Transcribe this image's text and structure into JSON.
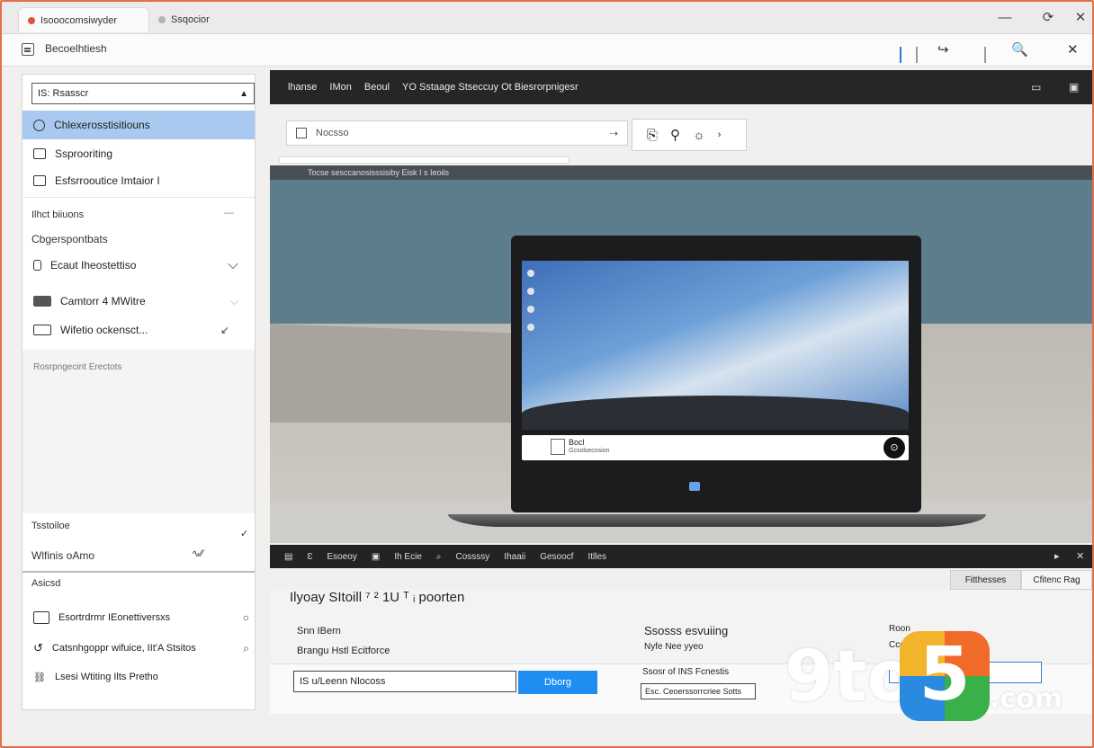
{
  "titlebar": {
    "tabs": [
      {
        "label": "Isooocomsiwyder"
      },
      {
        "label": "Ssqocior"
      }
    ],
    "controls": {
      "minimize": "—",
      "restore": "⟳",
      "close": "✕"
    }
  },
  "toolbar": {
    "address": "Becoelhtiesh",
    "icons": {
      "pin": "↪",
      "search": "🔍",
      "close": "✕"
    }
  },
  "sidebar": {
    "search": {
      "placeholder": "Rsasscr",
      "prefix": "IS:"
    },
    "items": [
      {
        "label": "Chlexerosstisitiouns"
      },
      {
        "label": "Ssprooriting"
      },
      {
        "label": "Esfsrrooutice Imtaior I"
      }
    ],
    "section1": {
      "heading": "Ilhct biiuons",
      "meta": "—"
    },
    "group_label": "Cbgerspontbats",
    "sub_items": [
      {
        "label": "Ecaut Iheostettiso"
      },
      {
        "label": "Camtorr 4 MWitre"
      },
      {
        "label": "Wifetio ockensct..."
      }
    ],
    "muted": "Rosrpngecint Erectots",
    "section2": {
      "heading": "Tsstoiloe",
      "value": "Wlfinis oAmo"
    },
    "section3": {
      "heading": "Asicsd"
    },
    "list": [
      {
        "label": "Esortrdrmr IEonettiversxs"
      },
      {
        "label": "Catsnhgoppr wifuice, IIt'A Stsitos"
      },
      {
        "label": "Lsesi Wtiting Ilts Pretho"
      }
    ]
  },
  "main": {
    "topbar": {
      "items": [
        "lhanse",
        "IMon",
        "Beoul",
        "YO Sstaage Stseccuy Ot Biesrorpnigesr"
      ]
    },
    "search2": {
      "placeholder": "Nocsso"
    },
    "hero": {
      "caption": "Tocse sesccanosisssisiby   Eisk   I s Ieoils",
      "panel_title": "Bocl",
      "panel_sub": "Gcsolsecosion"
    },
    "darkbar": {
      "items": [
        "Esoeoy",
        "Ih Ecie",
        "Cossssy",
        "Ihaaii",
        "Gesoocf",
        "Itlles"
      ]
    },
    "tabs": [
      {
        "label": "Fitthesses"
      },
      {
        "label": "Cfitenc Rag"
      }
    ],
    "bottom": {
      "heading": "Ilyoay SItoill ⁷ ² 1U ᵀ ᵢ poorten",
      "label1": "Snn IBern",
      "label2": "Brangu Hstl Ecitforce",
      "label3": "Ssosss esvuiing",
      "label4": "Nyfe Nee yyeo",
      "label5": "Ssosr of INS Fcnestis",
      "label6": "Roon",
      "label7": "Ccc",
      "input1": "IS u/Leenn Nlocoss",
      "button": "Dborg",
      "input2": "Esc. Ceoerssorrcriee Sotts"
    }
  },
  "watermark": {
    "prefix": "9to",
    "logo": "5",
    "suffix": ".com"
  }
}
